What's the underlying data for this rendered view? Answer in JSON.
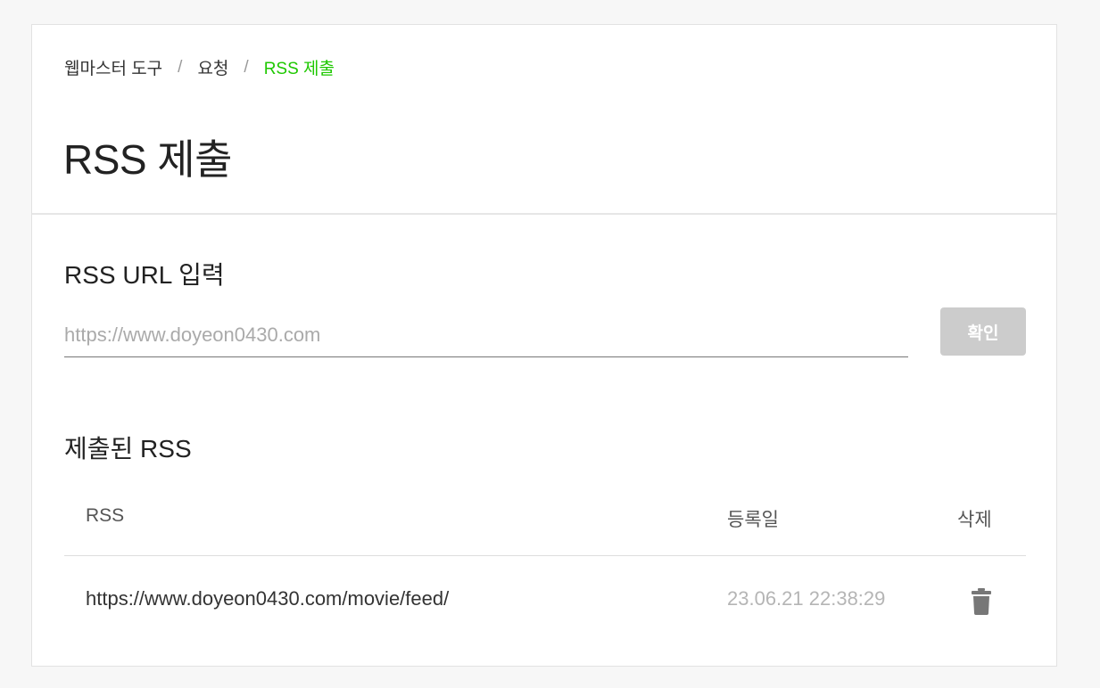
{
  "breadcrumb": {
    "items": [
      "웹마스터 도구",
      "요청",
      "RSS 제출"
    ],
    "separator": "/",
    "current_color": "#1ec800"
  },
  "page_title": "RSS 제출",
  "url_section": {
    "title": "RSS URL 입력",
    "input_placeholder": "https://www.doyeon0430.com",
    "input_value": "",
    "confirm_label": "확인"
  },
  "submitted_section": {
    "title": "제출된 RSS",
    "columns": {
      "rss": "RSS",
      "date": "등록일",
      "delete": "삭제"
    },
    "rows": [
      {
        "rss": "https://www.doyeon0430.com/movie/feed/",
        "date": "23.06.21 22:38:29",
        "delete_icon": "trash-icon"
      }
    ]
  }
}
